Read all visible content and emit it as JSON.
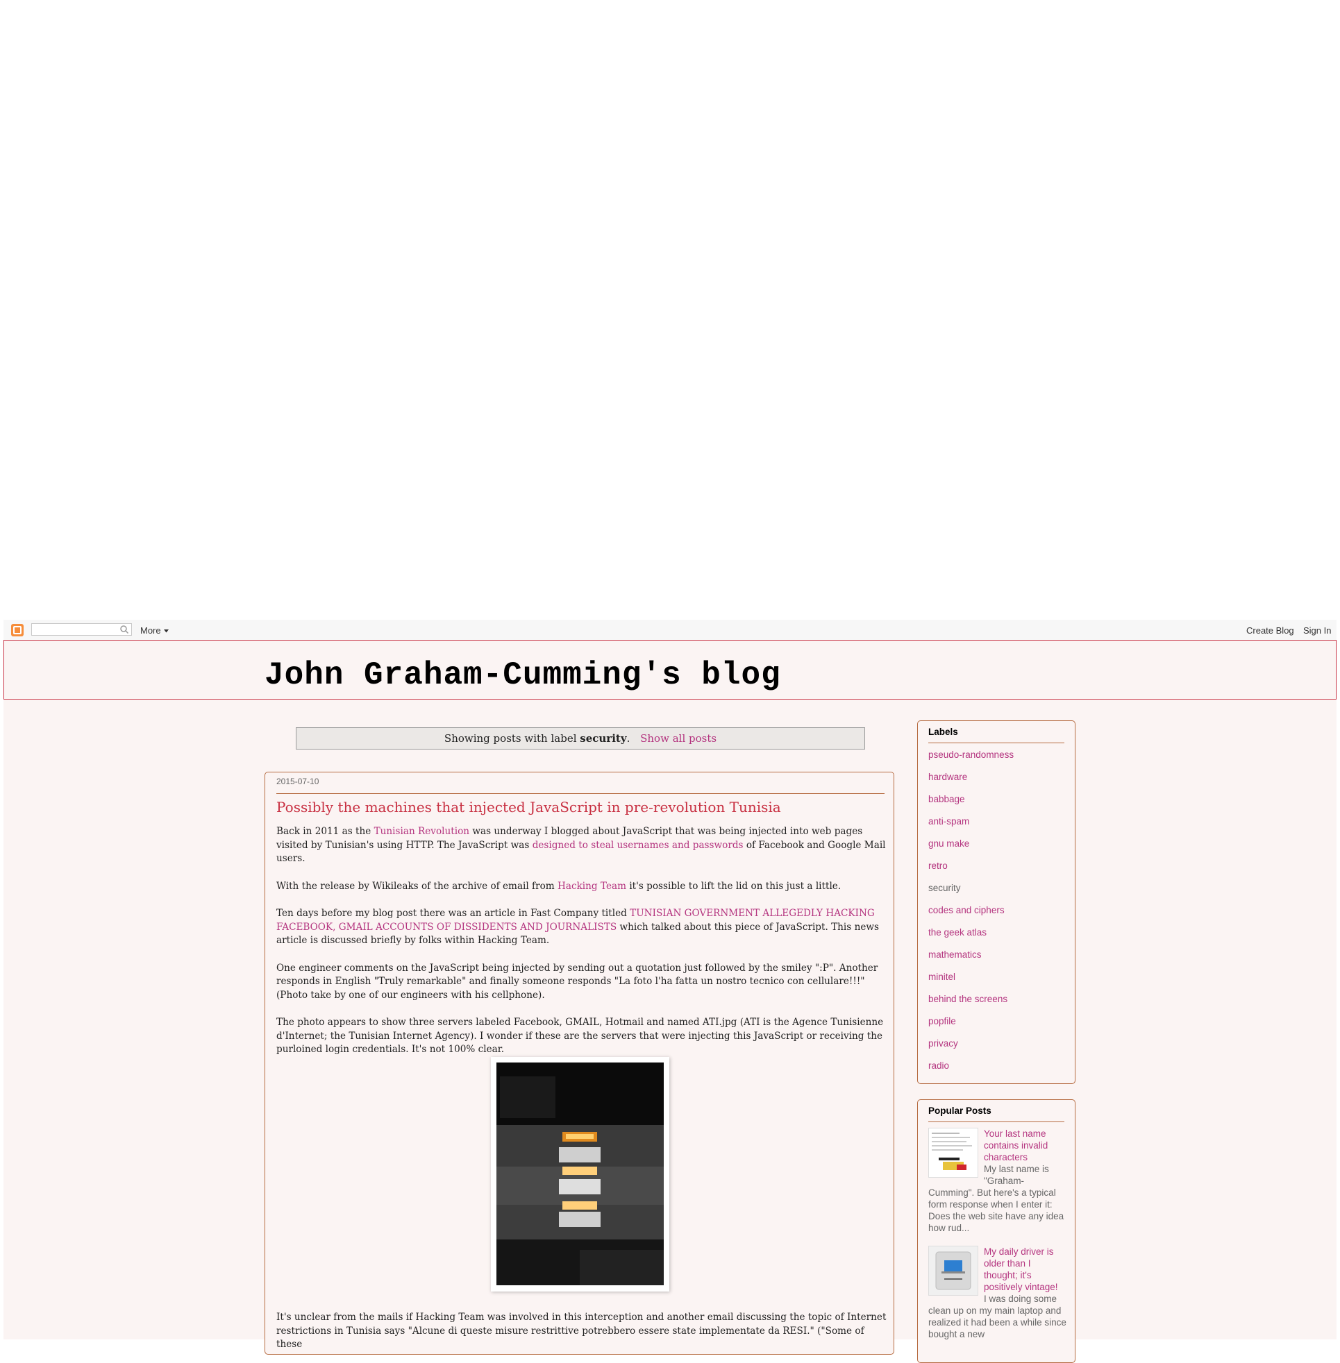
{
  "navbar": {
    "more_label": "More",
    "create_blog": "Create Blog",
    "sign_in": "Sign In",
    "search_placeholder": ""
  },
  "header": {
    "title": "John Graham-Cumming's blog"
  },
  "status": {
    "prefix": "Showing posts with label",
    "label": "security",
    "suffix": ".",
    "show_all": "Show all posts"
  },
  "post": {
    "date": "2015-07-10",
    "title": "Possibly the machines that injected JavaScript in pre-revolution Tunisia",
    "p1": {
      "t1": "Back in 2011 as the ",
      "l1": "Tunisian Revolution",
      "t2": " was underway I blogged about JavaScript that was being injected into web pages visited by Tunisian's using HTTP. The JavaScript was ",
      "l2": "designed to steal usernames and passwords",
      "t3": " of Facebook and Google Mail users."
    },
    "p2": {
      "t1": "With the release by Wikileaks of the archive of email from ",
      "l1": "Hacking Team",
      "t2": " it's possible to lift the lid on this just a little."
    },
    "p3": {
      "t1": "Ten days before my blog post there was an article in Fast Company titled ",
      "l1": "TUNISIAN GOVERNMENT ALLEGEDLY HACKING FACEBOOK, GMAIL ACCOUNTS OF DISSIDENTS AND JOURNALISTS",
      "t2": " which talked about this piece of JavaScript. This news article is discussed briefly by folks within Hacking Team."
    },
    "p4": "One engineer comments on the JavaScript being injected by sending out a quotation just followed by the smiley \":P\". Another responds in English \"Truly remarkable\" and finally someone responds \"La foto l'ha fatta un nostro tecnico con cellulare!!!\" (Photo take by one of our engineers with his cellphone).",
    "p5": "The photo appears to show three servers labeled Facebook, GMAIL, Hotmail and named ATI.jpg (ATI is the Agence Tunisienne d'Internet; the Tunisian Internet Agency). I wonder if these are the servers that were injecting this JavaScript or receiving the purloined login credentials. It's not 100% clear.",
    "p6": "It's unclear from the mails if Hacking Team was involved in this interception and another email discussing the topic of Internet restrictions in Tunisia says \"Alcune di queste misure restrittive potrebbero essere state implementate da RESI.\" (\"Some of these"
  },
  "labels_widget": {
    "title": "Labels",
    "items": [
      "pseudo-randomness",
      "hardware",
      "babbage",
      "anti-spam",
      "gnu make",
      "retro",
      "security",
      "codes and ciphers",
      "the geek atlas",
      "mathematics",
      "minitel",
      "behind the screens",
      "popfile",
      "privacy",
      "radio"
    ],
    "current": "security"
  },
  "popular_widget": {
    "title": "Popular Posts",
    "posts": [
      {
        "title": "Your last name contains invalid characters",
        "snippet": "My last name is \"Graham-Cumming\". But here's a typical form response when I enter it: Does the web site have any idea how rud..."
      },
      {
        "title": "My daily driver is older than I thought; it's positively vintage!",
        "snippet": "I was doing some clean up on my main laptop and realized it had been a while since bought a new"
      }
    ]
  },
  "colors": {
    "accent_link": "#b4347f",
    "title_red": "#c83042",
    "border_brown": "#b56a3f",
    "page_bg": "#fbf4f3"
  },
  "icons": [
    "blogger-logo-icon",
    "search-icon",
    "caret-down-icon"
  ]
}
